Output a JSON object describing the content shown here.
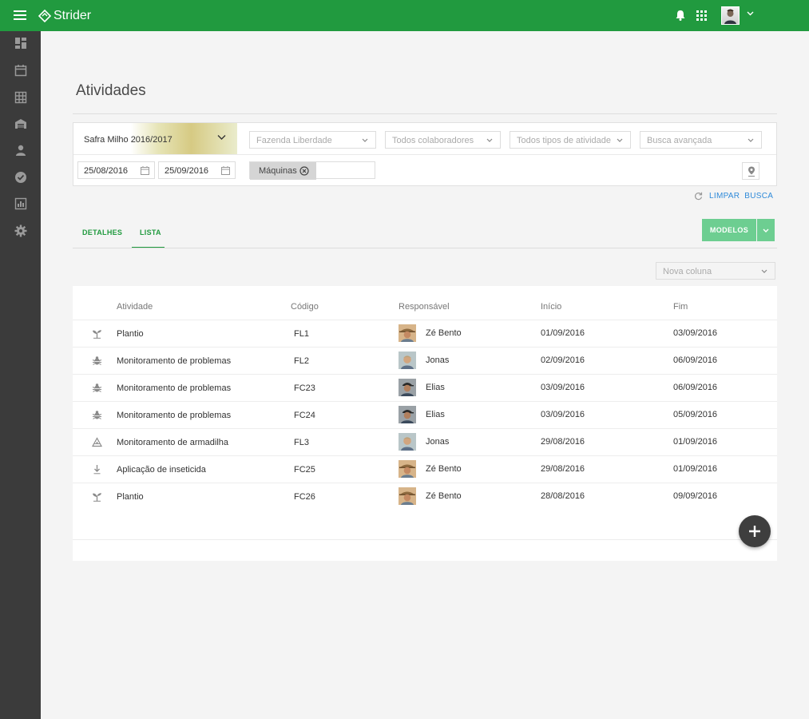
{
  "app": {
    "brand": "Strider",
    "brand_color": "#219a3f"
  },
  "topbar": {
    "icons": [
      "menu-icon",
      "notification-bell-icon",
      "apps-grid-icon",
      "user-avatar",
      "chevron-down-icon"
    ]
  },
  "sidebar": {
    "items": [
      "dashboard-icon",
      "calendar-icon",
      "map-grid-icon",
      "warehouse-icon",
      "person-icon",
      "check-circle-icon",
      "report-chart-icon",
      "settings-icon"
    ]
  },
  "page": {
    "title": "Atividades"
  },
  "filters": {
    "safra": "Safra Milho 2016/2017",
    "fazenda": "Fazenda Liberdade",
    "colaboradores": "Todos colaboradores",
    "tipos": "Todos tipos de atividade",
    "busca": "Busca avançada",
    "date_start": "25/08/2016",
    "date_end": "25/09/2016",
    "chip": "Máquinas",
    "chip_input_value": ""
  },
  "clear": {
    "word1": "LIMPAR",
    "word2": "BUSCA"
  },
  "tabs": [
    {
      "label": "DETALHES"
    },
    {
      "label": "LISTA",
      "active": true
    }
  ],
  "actions": {
    "modelos": "MODELOS",
    "nova_coluna": "Nova coluna"
  },
  "table": {
    "columns": [
      "Atividade",
      "Código",
      "Responsável",
      "Início",
      "Fim"
    ],
    "rows": [
      {
        "icon": "plant-sprout-icon",
        "atividade": "Plantio",
        "codigo": "FL1",
        "responsavel": "Zé Bento",
        "inicio": "01/09/2016",
        "fim": "03/09/2016"
      },
      {
        "icon": "bug-icon",
        "atividade": "Monitoramento de problemas",
        "codigo": "FL2",
        "responsavel": "Jonas",
        "inicio": "02/09/2016",
        "fim": "06/09/2016"
      },
      {
        "icon": "bug-icon",
        "atividade": "Monitoramento de problemas",
        "codigo": "FC23",
        "responsavel": "Elias",
        "inicio": "03/09/2016",
        "fim": "06/09/2016"
      },
      {
        "icon": "bug-icon",
        "atividade": "Monitoramento de problemas",
        "codigo": "FC24",
        "responsavel": "Elias",
        "inicio": "03/09/2016",
        "fim": "05/09/2016"
      },
      {
        "icon": "trap-triangle-icon",
        "atividade": "Monitoramento de armadilha",
        "codigo": "FL3",
        "responsavel": "Jonas",
        "inicio": "29/08/2016",
        "fim": "01/09/2016"
      },
      {
        "icon": "spray-drop-icon",
        "atividade": "Aplicação de inseticida",
        "codigo": "FC25",
        "responsavel": "Zé Bento",
        "inicio": "29/08/2016",
        "fim": "01/09/2016"
      },
      {
        "icon": "plant-sprout-icon",
        "atividade": "Plantio",
        "codigo": "FC26",
        "responsavel": "Zé Bento",
        "inicio": "28/08/2016",
        "fim": "09/09/2016"
      }
    ]
  },
  "fab": {
    "icon": "plus-icon"
  }
}
